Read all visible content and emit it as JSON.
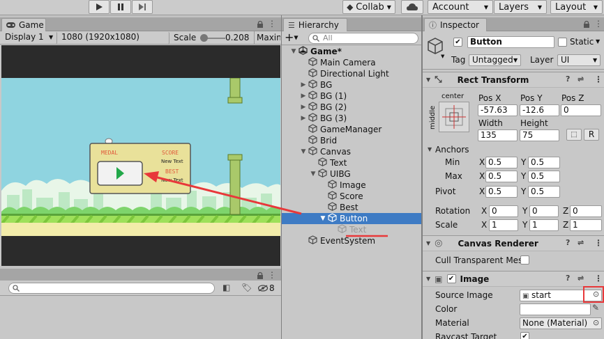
{
  "toolbar": {
    "collab": "Collab",
    "account": "Account",
    "layers": "Layers",
    "layout": "Layout"
  },
  "game": {
    "tab": "Game",
    "display": "Display 1",
    "resolution": "1080 (1920x1080)",
    "scale_label": "Scale",
    "scale_value": "0.208",
    "maximize": "Maxin",
    "panel": {
      "medal": "MEDAL",
      "score": "SCORE",
      "best": "BEST",
      "new_text_1": "New Text",
      "new_text_2": "New Text"
    }
  },
  "console": {
    "search_placeholder": "",
    "count": "8"
  },
  "hierarchy": {
    "tab": "Hierarchy",
    "search_placeholder": "All",
    "items": [
      {
        "label": "Game*",
        "depth": 0,
        "arrow": "down",
        "icon": "unity"
      },
      {
        "label": "Main Camera",
        "depth": 1,
        "arrow": ""
      },
      {
        "label": "Directional Light",
        "depth": 1,
        "arrow": ""
      },
      {
        "label": "BG",
        "depth": 1,
        "arrow": "right"
      },
      {
        "label": "BG (1)",
        "depth": 1,
        "arrow": "right"
      },
      {
        "label": "BG (2)",
        "depth": 1,
        "arrow": "right"
      },
      {
        "label": "BG (3)",
        "depth": 1,
        "arrow": "right"
      },
      {
        "label": "GameManager",
        "depth": 1,
        "arrow": ""
      },
      {
        "label": "Brid",
        "depth": 1,
        "arrow": ""
      },
      {
        "label": "Canvas",
        "depth": 1,
        "arrow": "down"
      },
      {
        "label": "Text",
        "depth": 2,
        "arrow": ""
      },
      {
        "label": "UIBG",
        "depth": 2,
        "arrow": "down"
      },
      {
        "label": "Image",
        "depth": 3,
        "arrow": ""
      },
      {
        "label": "Score",
        "depth": 3,
        "arrow": ""
      },
      {
        "label": "Best",
        "depth": 3,
        "arrow": ""
      },
      {
        "label": "Button",
        "depth": 3,
        "arrow": "down",
        "selected": true
      },
      {
        "label": "Text",
        "depth": 4,
        "arrow": "",
        "dim": true
      },
      {
        "label": "EventSystem",
        "depth": 1,
        "arrow": ""
      }
    ]
  },
  "inspector": {
    "tab": "Inspector",
    "name": "Button",
    "static": "Static",
    "tag_label": "Tag",
    "tag": "Untagged",
    "layer_label": "Layer",
    "layer": "UI",
    "rect": {
      "title": "Rect Transform",
      "anchor_h": "center",
      "anchor_v": "middle",
      "pos_x_label": "Pos X",
      "pos_y_label": "Pos Y",
      "pos_z_label": "Pos Z",
      "pos_x": "-57.63",
      "pos_y": "-12.6",
      "pos_z": "0",
      "width_label": "Width",
      "height_label": "Height",
      "width": "135",
      "height": "75",
      "r_btn": "R",
      "anchors": "Anchors",
      "min": "Min",
      "max": "Max",
      "min_x": "0.5",
      "min_y": "0.5",
      "max_x": "0.5",
      "max_y": "0.5",
      "pivot": "Pivot",
      "pivot_x": "0.5",
      "pivot_y": "0.5",
      "rotation": "Rotation",
      "rot_x": "0",
      "rot_y": "0",
      "rot_z": "0",
      "scale": "Scale",
      "scale_x": "1",
      "scale_y": "1",
      "scale_z": "1",
      "x": "X",
      "y": "Y",
      "z": "Z"
    },
    "canvas_renderer": {
      "title": "Canvas Renderer",
      "cull": "Cull Transparent Mes"
    },
    "image": {
      "title": "Image",
      "source_label": "Source Image",
      "source": "start",
      "color_label": "Color",
      "material_label": "Material",
      "material": "None (Material)",
      "raycast_label": "Raycast Target"
    }
  },
  "colors": {
    "selection": "#3e7bc4",
    "annotation": "#e8383a",
    "sky": "#8fd4e0"
  }
}
